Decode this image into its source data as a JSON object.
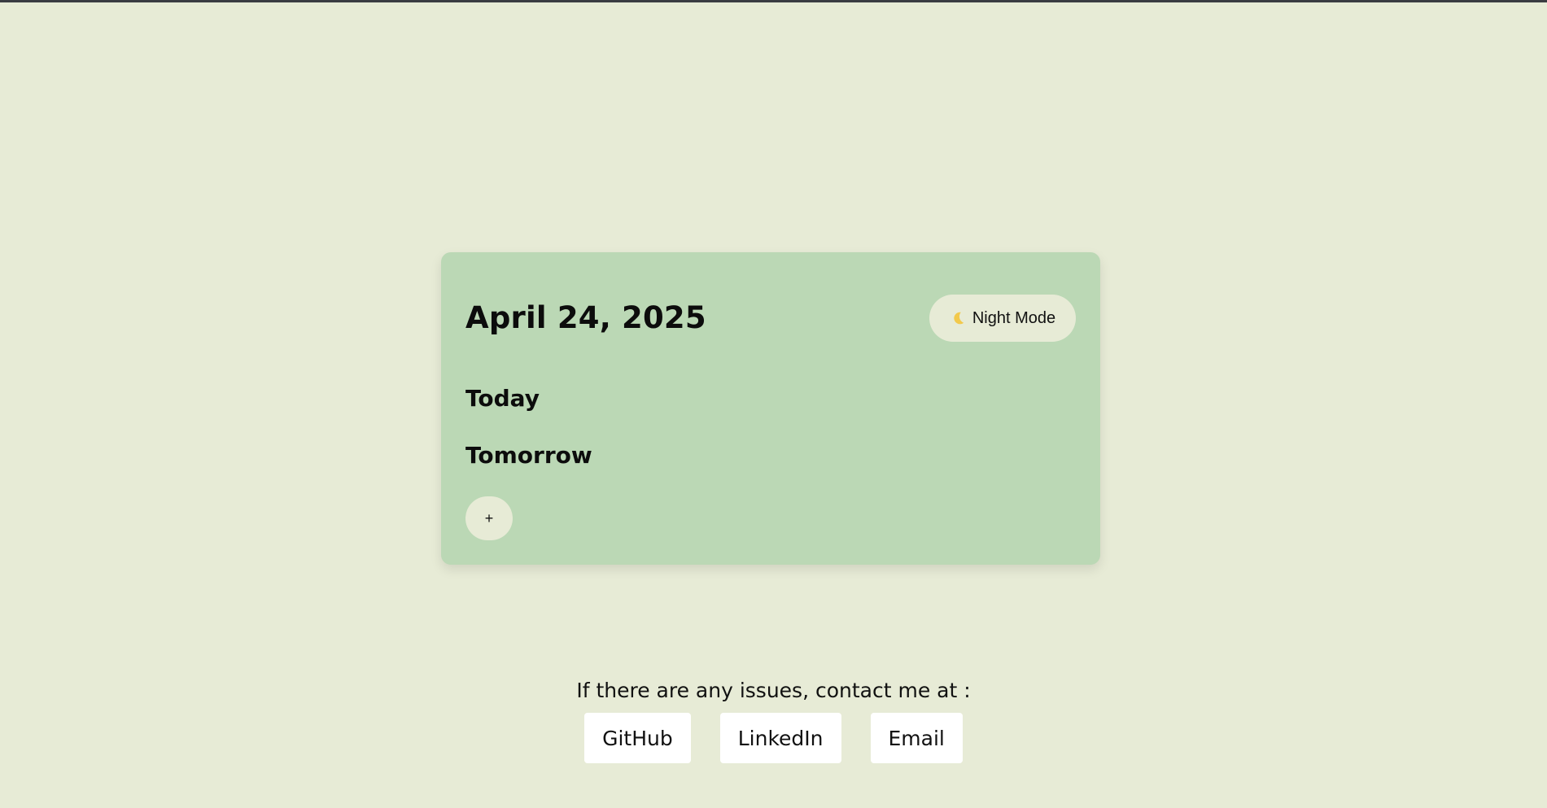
{
  "colors": {
    "page_background": "#e7ebd6",
    "card_background": "#bbd8b5",
    "button_background": "#e7ebd6",
    "link_button_background": "#ffffff",
    "moon_icon": "#f2c94c"
  },
  "card": {
    "date_title": "April 24, 2025",
    "night_mode": {
      "icon": "moon-icon",
      "label": "Night Mode"
    },
    "sections": {
      "today": "Today",
      "tomorrow": "Tomorrow"
    },
    "add_button_label": "+"
  },
  "footer": {
    "contact_text": "If there are any issues, contact me at :",
    "links": [
      {
        "label": "GitHub"
      },
      {
        "label": "LinkedIn"
      },
      {
        "label": "Email"
      }
    ]
  }
}
